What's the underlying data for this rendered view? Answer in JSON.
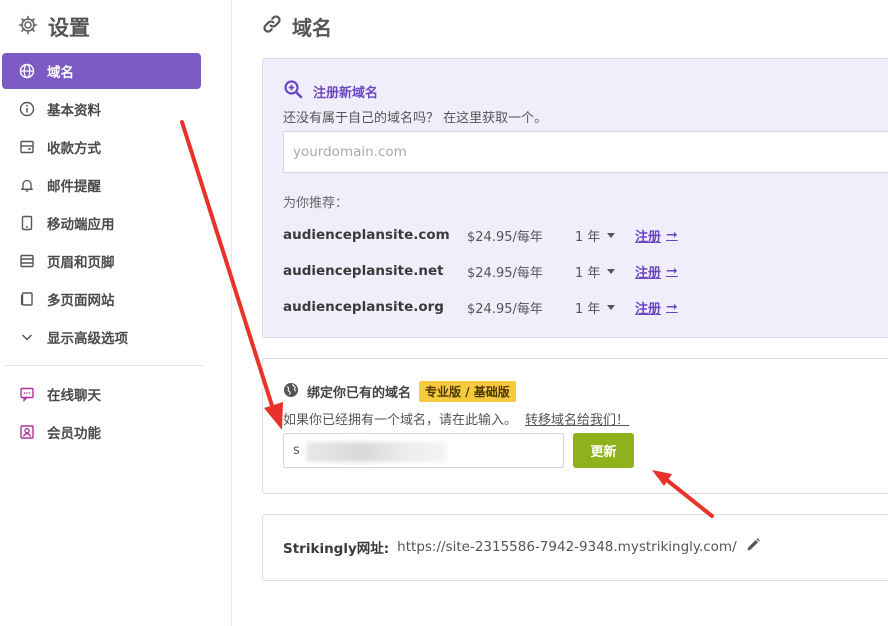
{
  "sidebar": {
    "title": "设置",
    "items": [
      {
        "label": "域名",
        "icon": "globe-icon",
        "active": true
      },
      {
        "label": "基本资料",
        "icon": "info-icon"
      },
      {
        "label": "收款方式",
        "icon": "wallet-icon"
      },
      {
        "label": "邮件提醒",
        "icon": "bell-icon"
      },
      {
        "label": "移动端应用",
        "icon": "mobile-icon"
      },
      {
        "label": "页眉和页脚",
        "icon": "layout-icon"
      },
      {
        "label": "多页面网站",
        "icon": "pages-icon"
      },
      {
        "label": "显示高级选项",
        "icon": "chevron-down-icon"
      }
    ],
    "extra_items": [
      {
        "label": "在线聊天",
        "icon": "chat-icon"
      },
      {
        "label": "会员功能",
        "icon": "member-icon"
      }
    ]
  },
  "main": {
    "title": "域名",
    "register": {
      "heading": "注册新域名",
      "description": "还没有属于自己的域名吗？ 在这里获取一个。",
      "placeholder": "yourdomain.com",
      "recommend_label": "为你推荐：",
      "suggestions": [
        {
          "domain": "audienceplansite.com",
          "price": "$24.95/每年",
          "years": "1 年",
          "action": "注册"
        },
        {
          "domain": "audienceplansite.net",
          "price": "$24.95/每年",
          "years": "1 年",
          "action": "注册"
        },
        {
          "domain": "audienceplansite.org",
          "price": "$24.95/每年",
          "years": "1 年",
          "action": "注册"
        }
      ]
    },
    "bind": {
      "heading": "绑定你已有的域名",
      "badge": "专业版 / 基础版",
      "description": "如果你已经拥有一个域名，请在此输入。",
      "transfer_link": "转移域名给我们！",
      "input_value": "s",
      "button": "更新"
    },
    "strikingly_url": {
      "label": "Strikingly网址:",
      "value": "https://site-2315586-7942-9348.mystrikingly.com/"
    }
  },
  "colors": {
    "accent_purple": "#7c5cc4",
    "update_green": "#8fb21c",
    "badge_yellow": "#f7c93e",
    "annotation_red": "#e8322a"
  }
}
